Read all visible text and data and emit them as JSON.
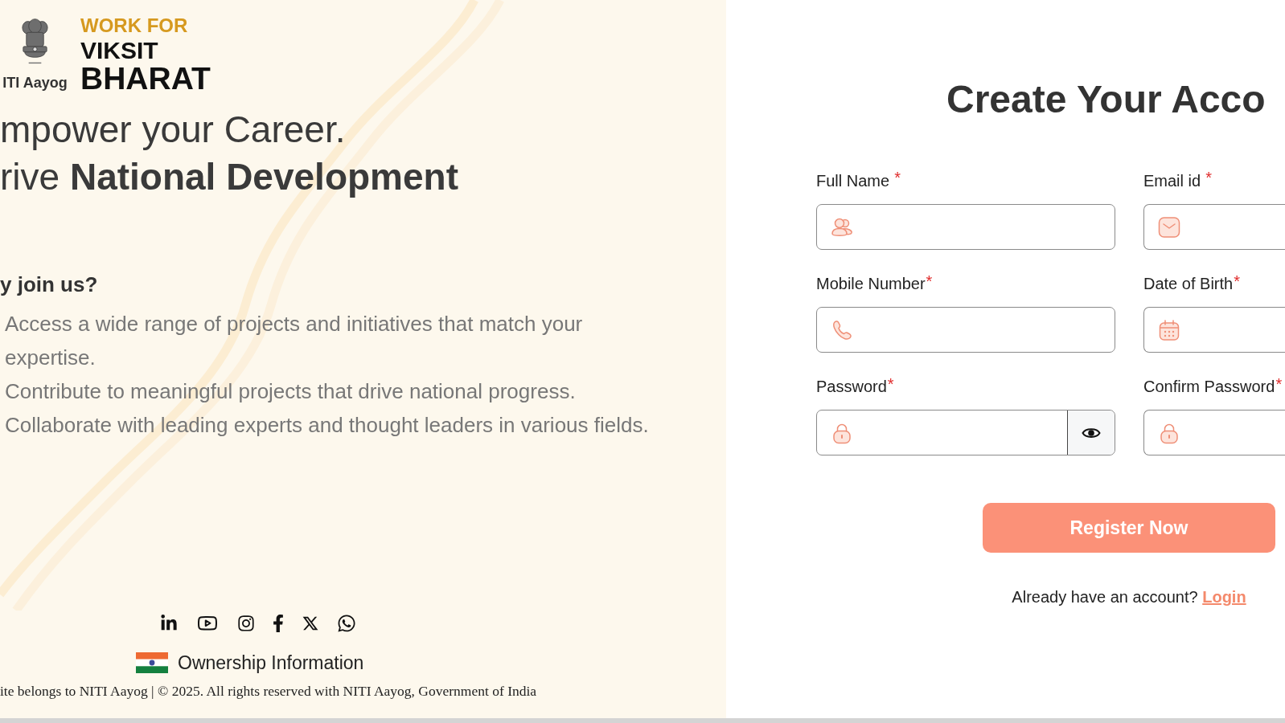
{
  "brand": {
    "emblem_caption": "ITI Aayog",
    "tagline_top": "WORK FOR",
    "tagline_middle": "VIKSIT",
    "tagline_bottom": "BHARAT"
  },
  "headline_lines": [
    "mpower your Career.",
    "rive **National Development**"
  ],
  "why_join": {
    "heading": "y join us?",
    "points": [
      "Access a wide range of projects and initiatives that match your expertise.",
      "Contribute to meaningful projects that drive national progress.",
      "Collaborate with leading experts and thought leaders in various fields."
    ]
  },
  "footer": {
    "ownership_link": "Ownership Information",
    "copyright": "ite belongs to NITI Aayog | © 2025. All rights reserved with NITI Aayog, Government of India"
  },
  "form": {
    "title": "Create Your Acco",
    "fields": [
      {
        "kind": "name",
        "label": "Full Name",
        "required_mark": "*"
      },
      {
        "kind": "email",
        "label": "Email id",
        "required_mark": "*"
      },
      {
        "kind": "phone",
        "label": "Mobile Number",
        "required_mark": "*"
      },
      {
        "kind": "date",
        "label": "Date of Birth",
        "required_mark": "*"
      },
      {
        "kind": "password",
        "label": "Password",
        "required_mark": "*",
        "show_toggle": true
      },
      {
        "kind": "password",
        "label": "Confirm Password",
        "required_mark": "*"
      }
    ],
    "submit_button": "Register Now",
    "login_prompt": {
      "text": "Already have an account?",
      "link": "Login"
    }
  }
}
